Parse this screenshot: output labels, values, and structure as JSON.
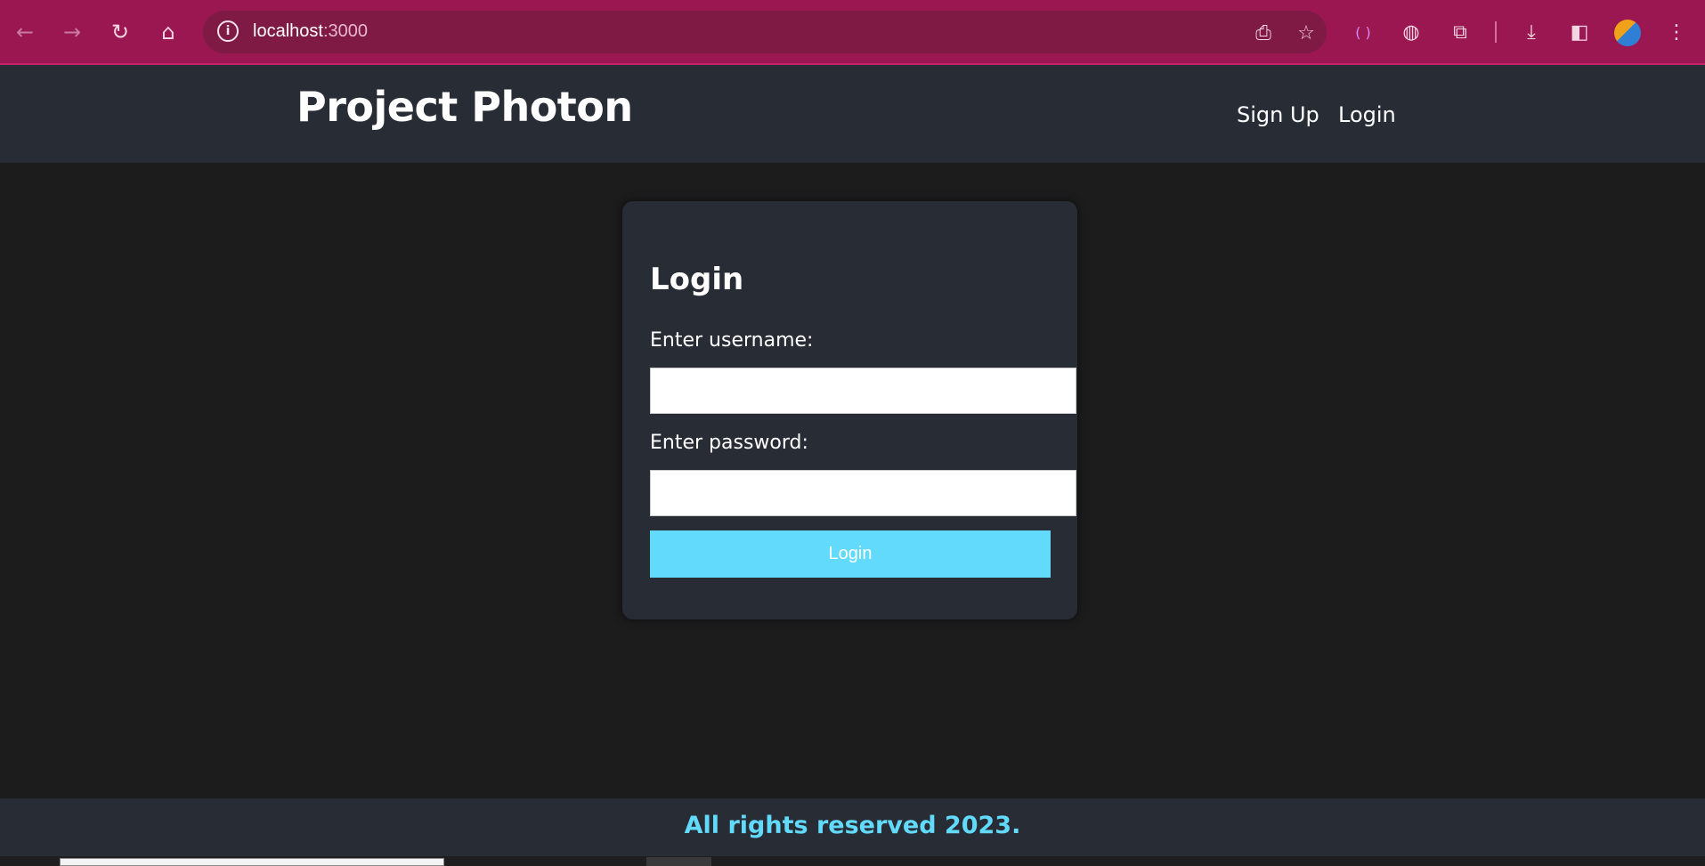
{
  "browser": {
    "url_host": "localhost",
    "url_port": ":3000"
  },
  "header": {
    "brand": "Project Photon",
    "nav": {
      "signup": "Sign Up",
      "login": "Login"
    }
  },
  "login_form": {
    "title": "Login",
    "username_label": "Enter username:",
    "username_value": "",
    "password_label": "Enter password:",
    "password_value": "",
    "submit_label": "Login"
  },
  "footer": {
    "text": "All rights reserved 2023."
  },
  "colors": {
    "browser_frame": "#9b1752",
    "header_bg": "#282c35",
    "page_bg": "#1c1c1d",
    "accent": "#61dafb"
  }
}
